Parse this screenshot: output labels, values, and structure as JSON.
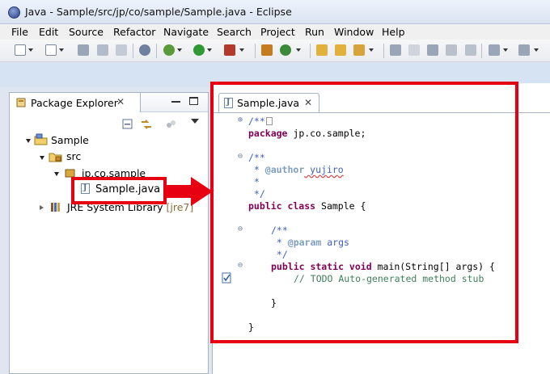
{
  "window": {
    "title": "Java - Sample/src/jp/co/sample/Sample.java - Eclipse"
  },
  "menu": [
    "File",
    "Edit",
    "Source",
    "Refactor",
    "Navigate",
    "Search",
    "Project",
    "Run",
    "Window",
    "Help"
  ],
  "package_explorer": {
    "tab_label": "Package Explorer",
    "close_glyph": "✕",
    "tree": {
      "project": "Sample",
      "src": "src",
      "package": "jp.co.sample",
      "file": "Sample.java",
      "library": "JRE System Library",
      "library_suffix": "[jre7]"
    }
  },
  "editor": {
    "tab_label": "Sample.java",
    "tab_icon_letter": "J",
    "close_glyph": "✕",
    "lines": {
      "l1": "/**",
      "l2_kw": "package",
      "l2_rest": " jp.co.sample;",
      "l3": "/**",
      "l4_pre": " * ",
      "l4_tag": "@author",
      "l4_post": " yujiro",
      "l5": " *",
      "l6": " */",
      "l7_kw": "public class",
      "l7_rest": " Sample {",
      "l8": "/**",
      "l9_pre": " * ",
      "l9_tag": "@param",
      "l9_post": " args",
      "l10": " */",
      "l11_kw": "public static void",
      "l11_rest": " main(String[] args) {",
      "l12": "// TODO Auto-generated method stub",
      "l13": "}",
      "l14": "}"
    }
  },
  "colors": {
    "highlight": "#e60012",
    "keyword": "#7f0055",
    "javadoc": "#3f5fbf",
    "comment": "#3f7f5f"
  },
  "icons": [
    "eclipse-icon",
    "package-explorer-icon",
    "project-folder-icon",
    "source-folder-icon",
    "package-icon",
    "java-file-icon",
    "library-icon",
    "collapse-all-icon",
    "link-editor-icon",
    "view-menu-icon",
    "minimize-icon",
    "maximize-icon",
    "close-icon",
    "task-marker-icon"
  ]
}
